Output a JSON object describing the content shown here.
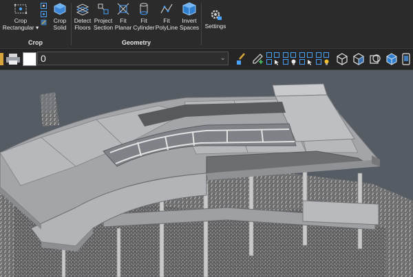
{
  "ribbon": {
    "crop_group": {
      "title": "Crop",
      "crop_rectangular": {
        "line1": "Crop",
        "line2": "Rectangular ▾"
      },
      "crop_solid": {
        "line1": "Crop",
        "line2": "Solid"
      }
    },
    "geometry_group": {
      "title": "Geometry",
      "detect_floors": {
        "line1": "Detect",
        "line2": "Floors"
      },
      "project_section": {
        "line1": "Project",
        "line2": "Section"
      },
      "fit_planar": {
        "line1": "Fit",
        "line2": "Planar"
      },
      "fit_cylinder": {
        "line1": "Fit",
        "line2": "Cylinder"
      },
      "fit_polyline": {
        "line1": "Fit",
        "line2": "PolyLine"
      },
      "invert_spaces": {
        "line1": "Invert",
        "line2": "Spaces"
      }
    },
    "settings": {
      "label": "Settings"
    }
  },
  "toolbar": {
    "layer_value": "0",
    "color_swatch": "#ffffff"
  },
  "colors": {
    "accent_blue": "#4aa3ff",
    "ribbon_bg": "#2b2b2b",
    "viewport_bg": "#565c64"
  }
}
